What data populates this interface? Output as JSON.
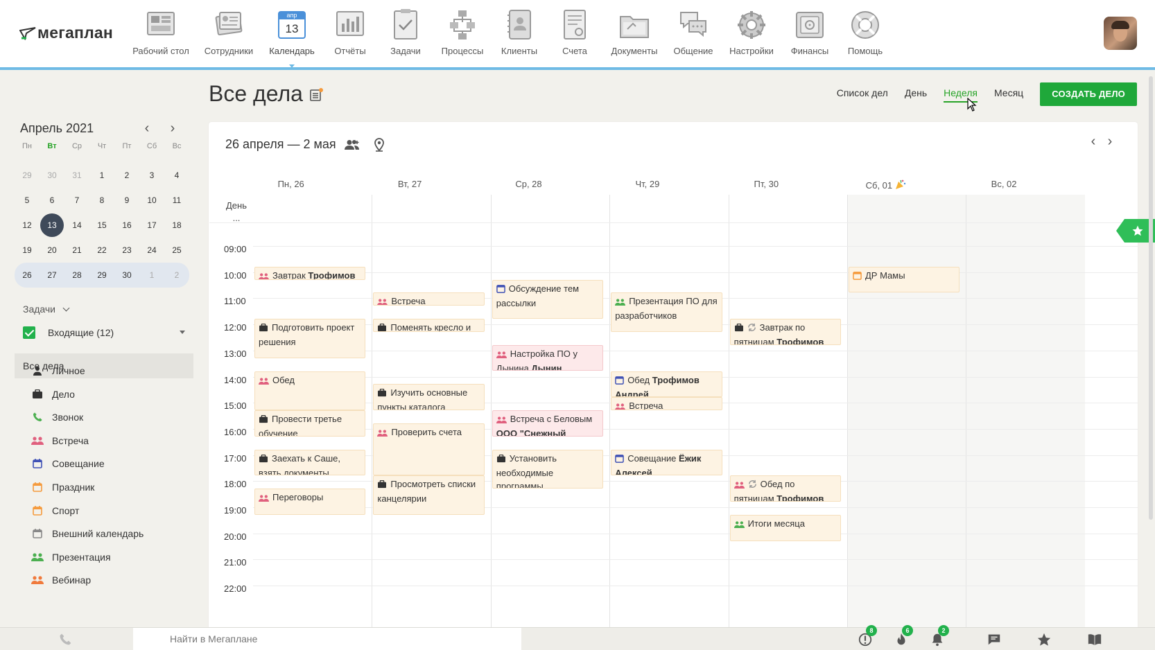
{
  "app": {
    "logo": "мегаплан"
  },
  "nav": [
    {
      "label": "Рабочий стол",
      "icon": "desktop-icon"
    },
    {
      "label": "Сотрудники",
      "icon": "employees-icon"
    },
    {
      "label": "Календарь",
      "icon": "calendar-icon",
      "badge_month": "апр",
      "badge_day": "13",
      "active": true
    },
    {
      "label": "Отчёты",
      "icon": "reports-icon"
    },
    {
      "label": "Задачи",
      "icon": "tasks-icon"
    },
    {
      "label": "Процессы",
      "icon": "processes-icon"
    },
    {
      "label": "Клиенты",
      "icon": "clients-icon"
    },
    {
      "label": "Счета",
      "icon": "invoices-icon"
    },
    {
      "label": "Документы",
      "icon": "documents-icon"
    },
    {
      "label": "Общение",
      "icon": "chat-icon"
    },
    {
      "label": "Настройки",
      "icon": "settings-icon"
    },
    {
      "label": "Финансы",
      "icon": "finance-icon"
    },
    {
      "label": "Помощь",
      "icon": "help-icon"
    }
  ],
  "sidebar": {
    "month_title": "Апрель 2021",
    "weekdays": [
      "Пн",
      "Вт",
      "Ср",
      "Чт",
      "Пт",
      "Сб",
      "Вс"
    ],
    "weeks": [
      [
        "29",
        "30",
        "31",
        "1",
        "2",
        "3",
        "4"
      ],
      [
        "5",
        "6",
        "7",
        "8",
        "9",
        "10",
        "11"
      ],
      [
        "12",
        "13",
        "14",
        "15",
        "16",
        "17",
        "18"
      ],
      [
        "19",
        "20",
        "21",
        "22",
        "23",
        "24",
        "25"
      ],
      [
        "26",
        "27",
        "28",
        "29",
        "30",
        "1",
        "2"
      ]
    ],
    "today": "13",
    "tasks_label": "Задачи",
    "inbox_label": "Входящие (12)",
    "all_tasks": "Все дела",
    "categories": [
      {
        "label": "Личное",
        "icon": "person-icon",
        "color": "#333333"
      },
      {
        "label": "Дело",
        "icon": "briefcase-icon",
        "color": "#333333"
      },
      {
        "label": "Звонок",
        "icon": "phone-icon",
        "color": "#4caf50"
      },
      {
        "label": "Встреча",
        "icon": "meeting-icon",
        "color": "#e0607e"
      },
      {
        "label": "Совещание",
        "icon": "conference-icon",
        "color": "#3f51b5"
      },
      {
        "label": "Праздник",
        "icon": "holiday-icon",
        "color": "#f59a3c"
      },
      {
        "label": "Спорт",
        "icon": "sport-icon",
        "color": "#f59a3c"
      },
      {
        "label": "Внешний календарь",
        "icon": "external-calendar-icon",
        "color": "#888888"
      },
      {
        "label": "Презентация",
        "icon": "presentation-icon",
        "color": "#4caf50"
      },
      {
        "label": "Вебинар",
        "icon": "webinar-icon",
        "color": "#f07a3c"
      }
    ]
  },
  "main": {
    "title": "Все дела",
    "views": [
      "Список дел",
      "День",
      "Неделя",
      "Месяц"
    ],
    "active_view": "Неделя",
    "create_button": "СОЗДАТЬ ДЕЛО",
    "range": "26 апреля — 2 мая",
    "days": [
      "Пн, 26",
      "Вт, 27",
      "Ср, 28",
      "Чт, 29",
      "Пт, 30",
      "Сб, 01",
      "Вс, 02"
    ],
    "allday_label": "День\n...",
    "hours": [
      "09:00",
      "10:00",
      "11:00",
      "12:00",
      "13:00",
      "14:00",
      "15:00",
      "16:00",
      "17:00",
      "18:00",
      "19:00",
      "20:00",
      "21:00",
      "22:00"
    ]
  },
  "events": [
    {
      "day": 0,
      "start": 10.0,
      "end": 10.5,
      "icon": "meeting",
      "text": "Завтрак ",
      "bold": "Трофимов"
    },
    {
      "day": 0,
      "start": 12.0,
      "end": 13.5,
      "icon": "briefcase",
      "text": "Подготовить проект решения",
      "bold": ""
    },
    {
      "day": 0,
      "start": 14.0,
      "end": 15.5,
      "icon": "meeting",
      "text": "Обед",
      "bold": ""
    },
    {
      "day": 0,
      "start": 15.5,
      "end": 16.5,
      "icon": "briefcase",
      "text": "Провести третье обучение",
      "bold": ""
    },
    {
      "day": 0,
      "start": 17.0,
      "end": 18.0,
      "icon": "briefcase",
      "text": "Заехать к Саше, взять документы",
      "bold": ""
    },
    {
      "day": 0,
      "start": 18.5,
      "end": 19.5,
      "icon": "meeting",
      "text": "Переговоры",
      "bold": ""
    },
    {
      "day": 1,
      "start": 11.0,
      "end": 11.5,
      "icon": "meeting",
      "text": "Встреча",
      "bold": ""
    },
    {
      "day": 1,
      "start": 12.0,
      "end": 12.5,
      "icon": "briefcase",
      "text": "Поменять кресло и",
      "bold": ""
    },
    {
      "day": 1,
      "start": 14.5,
      "end": 15.5,
      "icon": "briefcase",
      "text": "Изучить основные пункты каталога",
      "bold": ""
    },
    {
      "day": 1,
      "start": 16.0,
      "end": 18.0,
      "icon": "meeting",
      "text": "Проверить счета",
      "bold": ""
    },
    {
      "day": 1,
      "start": 18.0,
      "end": 19.5,
      "icon": "briefcase",
      "text": "Просмотреть списки канцелярии",
      "bold": ""
    },
    {
      "day": 2,
      "start": 10.5,
      "end": 12.0,
      "icon": "conference",
      "text": "Обсуждение тем рассылки",
      "bold": ""
    },
    {
      "day": 2,
      "start": 13.0,
      "end": 14.0,
      "icon": "meeting",
      "text": "Настройка ПО у Дынина ",
      "bold": "Дынин Товарищ",
      "pink": true
    },
    {
      "day": 2,
      "start": 15.5,
      "end": 16.5,
      "icon": "meeting",
      "text": "Встреча с Беловым ",
      "bold": "ООО \"Снежный",
      "pink": true
    },
    {
      "day": 2,
      "start": 17.0,
      "end": 18.5,
      "icon": "briefcase",
      "text": "Установить необходимые программы",
      "bold": ""
    },
    {
      "day": 3,
      "start": 11.0,
      "end": 12.5,
      "icon": "presentation",
      "text": "Презентация ПО для разработчиков",
      "bold": ""
    },
    {
      "day": 3,
      "start": 14.0,
      "end": 15.0,
      "icon": "conference",
      "text": "Обед ",
      "bold": "Трофимов Андрей"
    },
    {
      "day": 3,
      "start": 15.0,
      "end": 15.5,
      "icon": "meeting",
      "text": "Встреча",
      "bold": ""
    },
    {
      "day": 3,
      "start": 17.0,
      "end": 18.0,
      "icon": "conference",
      "text": "Совещание ",
      "bold": "Ёжик Алексей"
    },
    {
      "day": 4,
      "start": 12.0,
      "end": 13.0,
      "icon": "briefcase-repeat",
      "text": "Завтрак по пятницам ",
      "bold": "Трофимов"
    },
    {
      "day": 4,
      "start": 18.0,
      "end": 19.0,
      "icon": "meeting-repeat",
      "text": "Обед по пятницам ",
      "bold": "Трофимов"
    },
    {
      "day": 4,
      "start": 19.5,
      "end": 20.5,
      "icon": "presentation",
      "text": "Итоги месяца",
      "bold": ""
    },
    {
      "day": 5,
      "start": 10.0,
      "end": 11.0,
      "icon": "holiday",
      "text": "ДР Мамы",
      "bold": ""
    }
  ],
  "bottombar": {
    "search_placeholder": "Найти в Мегаплане",
    "badges": {
      "alerts": "8",
      "hot": "6",
      "notifications": "2"
    }
  },
  "colors": {
    "accent": "#1fa83a",
    "nav_underline": "#6fbbe5",
    "event_bg": "#fdf3e3",
    "event_pink": "#fde9ea"
  }
}
